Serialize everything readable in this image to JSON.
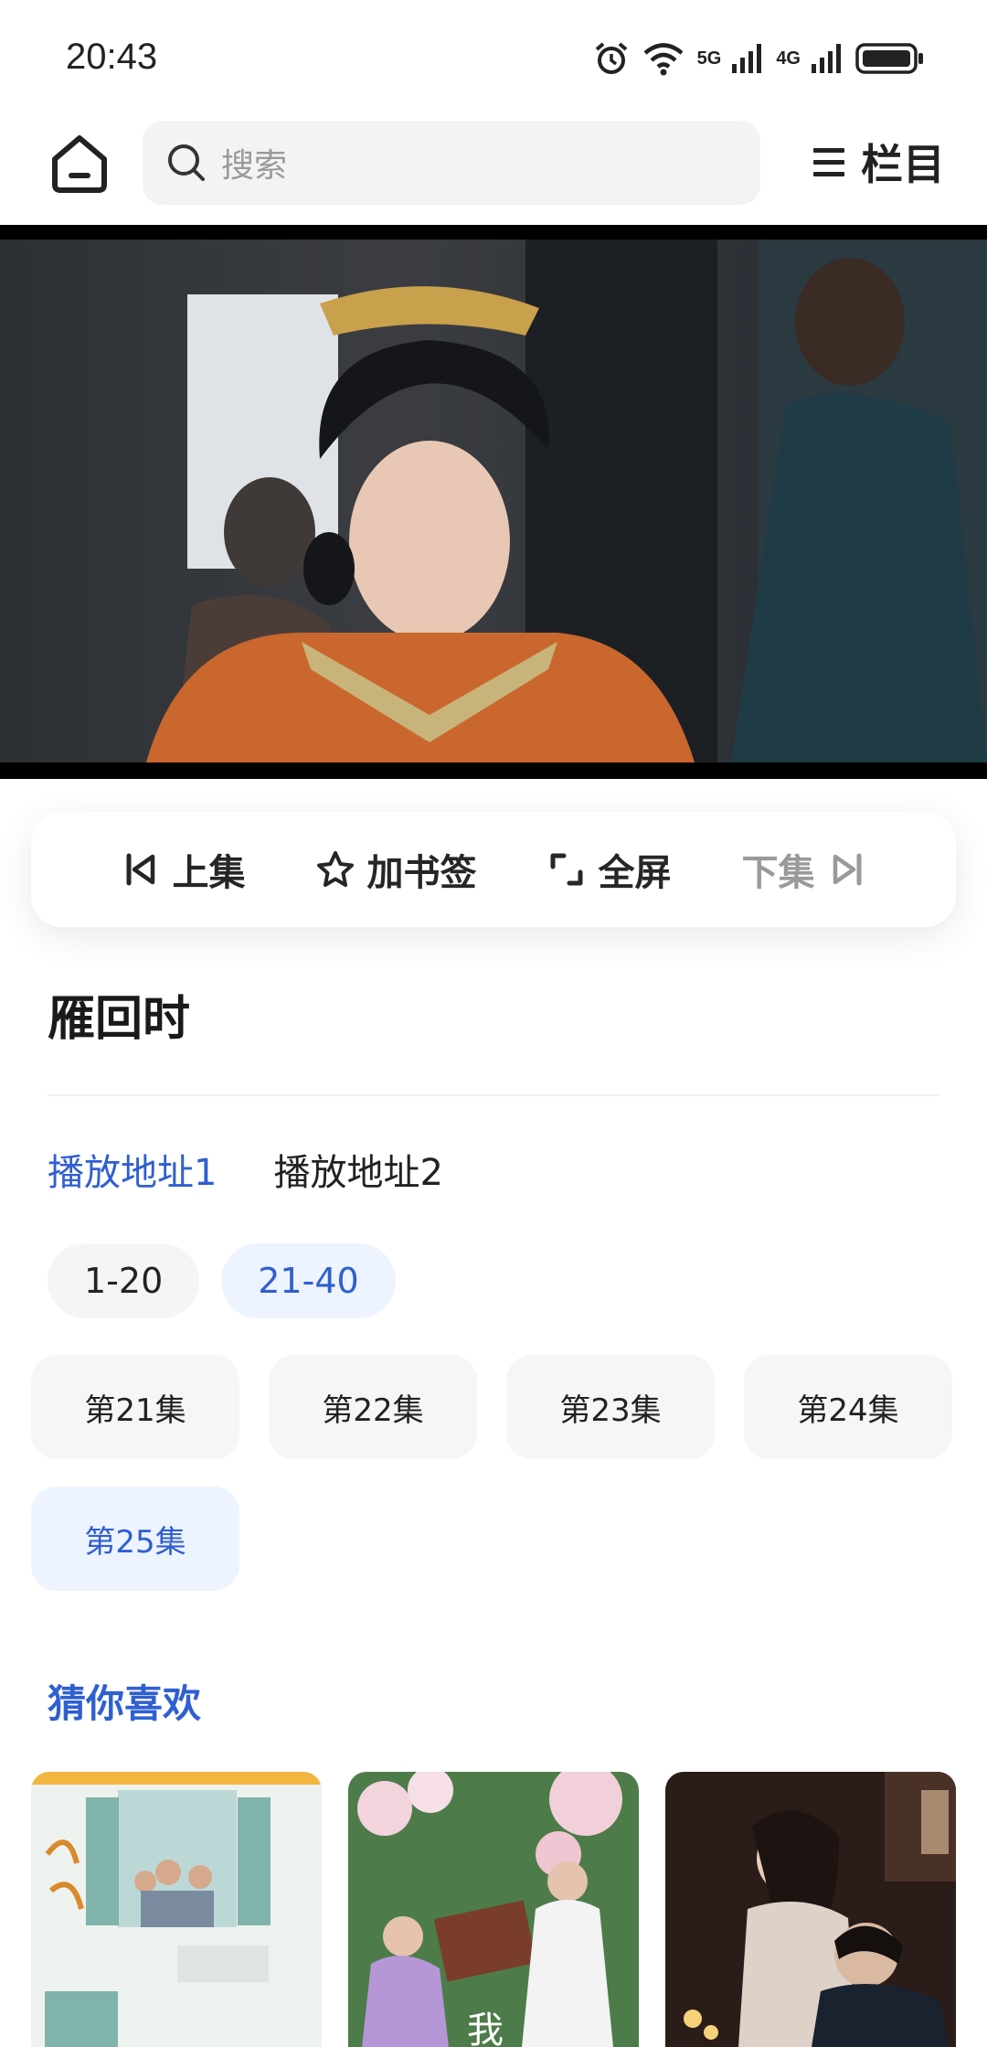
{
  "status_bar": {
    "time": "20:43",
    "net1": "5G",
    "net2": "4G",
    "icons": [
      "alarm-icon",
      "wifi-icon",
      "signal-5g-icon",
      "signal-4g-icon",
      "battery-icon"
    ]
  },
  "search": {
    "placeholder": "搜索"
  },
  "menu": {
    "label": "栏目",
    "icon": "hamburger-icon"
  },
  "controls": {
    "prev_label": "上集",
    "bookmark_label": "加书签",
    "fullscreen_label": "全屏",
    "next_label": "下集"
  },
  "title": "雁回时",
  "sources": [
    {
      "label": "播放地址1",
      "active": true
    },
    {
      "label": "播放地址2",
      "active": false
    }
  ],
  "ranges": [
    {
      "label": "1-20",
      "active": false
    },
    {
      "label": "21-40",
      "active": true
    }
  ],
  "episodes": [
    {
      "label": "第21集",
      "active": false
    },
    {
      "label": "第22集",
      "active": false
    },
    {
      "label": "第23集",
      "active": false
    },
    {
      "label": "第24集",
      "active": false
    },
    {
      "label": "第25集",
      "active": true
    }
  ],
  "recommend": {
    "title": "猜你喜欢"
  },
  "colors": {
    "accent": "#2f5fd0",
    "accent_bg": "#edf3ff",
    "chip_bg": "#f5f5f5"
  }
}
